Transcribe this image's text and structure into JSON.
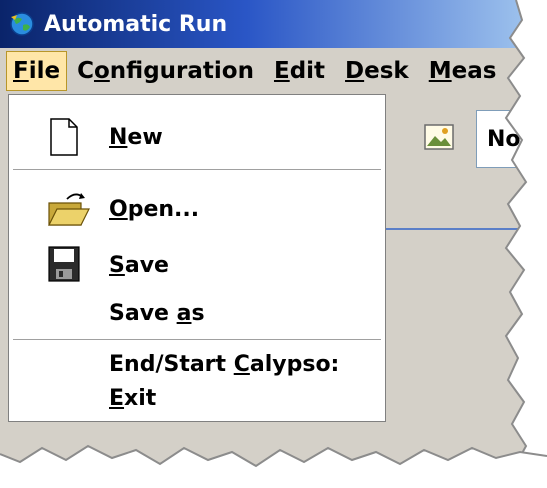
{
  "window": {
    "title": "Automatic Run"
  },
  "menubar": {
    "items": [
      {
        "name": "file",
        "pre": "",
        "ul": "F",
        "post": "ile"
      },
      {
        "name": "configuration",
        "pre": "C",
        "ul": "o",
        "post": "nfiguration"
      },
      {
        "name": "edit",
        "pre": "",
        "ul": "E",
        "post": "dit"
      },
      {
        "name": "desk",
        "pre": "",
        "ul": "D",
        "post": "esk"
      },
      {
        "name": "measure",
        "pre": "",
        "ul": "M",
        "post": "eas"
      }
    ]
  },
  "toolbar": {
    "field_text": "No"
  },
  "file_menu": {
    "new": {
      "pre": "",
      "ul": "N",
      "post": "ew"
    },
    "open": {
      "pre": "",
      "ul": "O",
      "post": "pen..."
    },
    "save": {
      "pre": "",
      "ul": "S",
      "post": "ave"
    },
    "save_as": {
      "pre": "Save ",
      "ul": "a",
      "post": "s"
    },
    "end_start": {
      "pre": "End/Start ",
      "ul": "C",
      "post": "alypso:"
    },
    "exit": {
      "pre": "",
      "ul": "E",
      "post": "xit"
    }
  },
  "icons": {
    "app": "globe-icon",
    "new": "new-document-icon",
    "open": "open-folder-icon",
    "save": "floppy-disk-icon",
    "picture": "picture-icon"
  },
  "colors": {
    "titlebar_start": "#0a246a",
    "titlebar_end": "#a6caf0",
    "menu_highlight": "#ffe6a8",
    "window_gray": "#d4d0c8"
  }
}
